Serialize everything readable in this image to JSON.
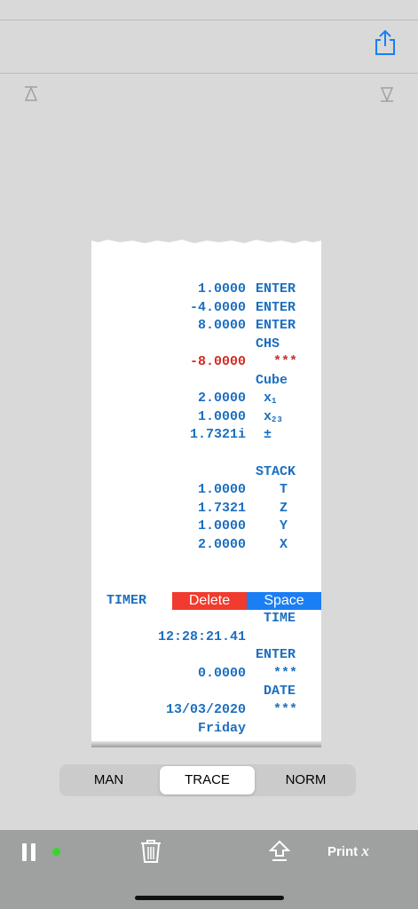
{
  "header": {
    "share_icon": "share-icon"
  },
  "scroll_controls": {
    "top_icon": "scroll-to-top-icon",
    "bottom_icon": "scroll-to-bottom-icon"
  },
  "tape": {
    "lines": [
      {
        "value": "1.0000",
        "op": "ENTER"
      },
      {
        "value": "-4.0000",
        "op": "ENTER"
      },
      {
        "value": "8.0000",
        "op": "ENTER"
      },
      {
        "value": "",
        "op": "CHS"
      },
      {
        "value": "-8.0000",
        "op": "***",
        "color": "#d42b23"
      },
      {
        "value": "",
        "op": "Cube"
      },
      {
        "value": "2.0000",
        "op": " x",
        "sub": "1"
      },
      {
        "value": "1.0000",
        "op": " x",
        "sub": "23"
      },
      {
        "value": "1.7321i",
        "op": " ±"
      },
      {
        "value": "",
        "op": "STACK"
      },
      {
        "value": "1.0000",
        "op": "   T"
      },
      {
        "value": "1.7321",
        "op": "   Z"
      },
      {
        "value": "1.0000",
        "op": "   Y"
      },
      {
        "value": "2.0000",
        "op": "   X"
      }
    ],
    "timer_label": "TIMER",
    "delete_label": "Delete",
    "space_label": "Space",
    "time_op": " TIME",
    "time_value": "12:28:21.41",
    "enter_op": "ENTER",
    "zero_value": "0.0000",
    "stars_op": "***",
    "date_op": " DATE",
    "date_value": "13/03/2020",
    "date_stars": "***",
    "weekday": "Friday"
  },
  "modes": {
    "items": [
      "MAN",
      "TRACE",
      "NORM"
    ],
    "selected": "TRACE"
  },
  "toolbar": {
    "pause_icon": "pause-icon",
    "status_color": "#39d431",
    "trash_icon": "trash-icon",
    "upload_icon": "upload-icon",
    "print_label": "Print",
    "print_symbol": "x"
  },
  "colors": {
    "tape_blue": "#1b6fc0",
    "tape_red": "#d42b23",
    "delete": "#f03b2e",
    "space": "#1a7ef5"
  }
}
